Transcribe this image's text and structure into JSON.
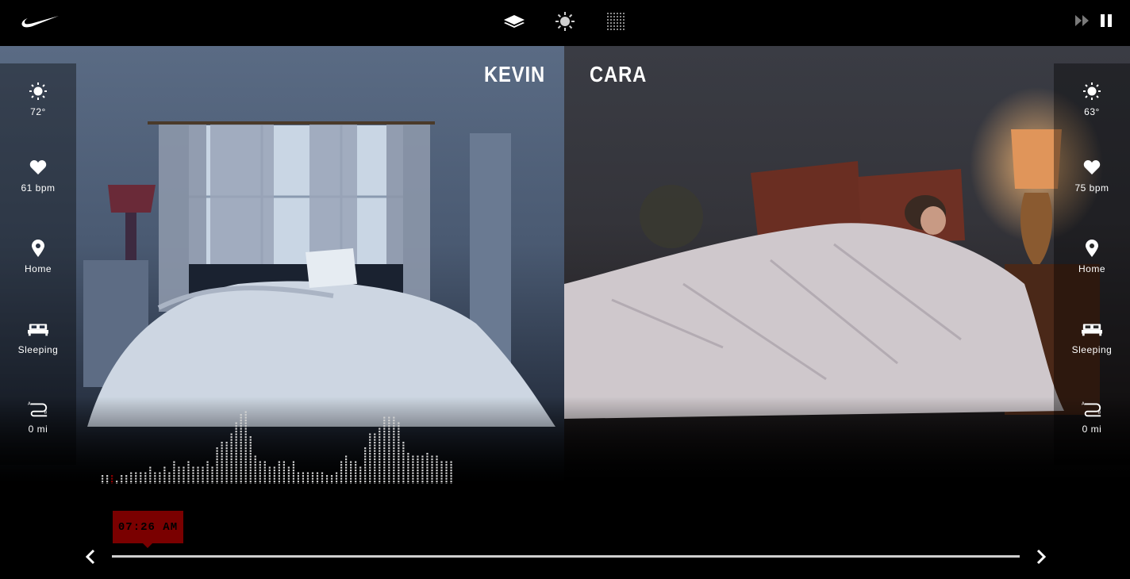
{
  "header": {
    "logo": "nike-swoosh-logo",
    "view_icons": [
      "layers-icon",
      "sun-icon",
      "grid-icon"
    ],
    "controls": [
      "fast-forward-icon",
      "pause-icon"
    ]
  },
  "people": [
    {
      "name": "KEVIN",
      "stats": [
        {
          "icon": "sun-icon",
          "label": "72°"
        },
        {
          "icon": "heart-icon",
          "label": "61 bpm"
        },
        {
          "icon": "location-pin-icon",
          "label": "Home"
        },
        {
          "icon": "bed-icon",
          "label": "Sleeping"
        },
        {
          "icon": "route-icon",
          "label": "0 mi"
        }
      ],
      "activity_levels": [
        2,
        2,
        2,
        1,
        2,
        2,
        3,
        3,
        3,
        3,
        4,
        3,
        3,
        4,
        3,
        5,
        4,
        4,
        5,
        4,
        4,
        4,
        5,
        4,
        8,
        9,
        9,
        11,
        13,
        15,
        18,
        10,
        6,
        5,
        5,
        4,
        4,
        5,
        5,
        4,
        5,
        3,
        3,
        3,
        3,
        3,
        3,
        2,
        2,
        3,
        5,
        6,
        5,
        5,
        4,
        8,
        11,
        11,
        12,
        14,
        14,
        14,
        13,
        9,
        7,
        6,
        6,
        6,
        7,
        6,
        6,
        5,
        5,
        5
      ]
    },
    {
      "name": "CARA",
      "stats": [
        {
          "icon": "sun-icon",
          "label": "63°"
        },
        {
          "icon": "heart-icon",
          "label": "75 bpm"
        },
        {
          "icon": "location-pin-icon",
          "label": "Home"
        },
        {
          "icon": "bed-icon",
          "label": "Sleeping"
        },
        {
          "icon": "route-icon",
          "label": "0 mi"
        }
      ],
      "activity_levels": [
        4,
        5,
        7,
        8,
        10,
        11,
        11,
        12,
        11,
        12,
        10,
        11,
        10,
        9,
        8,
        12,
        11,
        11,
        12,
        11,
        12,
        11,
        12,
        10,
        9,
        6,
        6,
        7,
        6,
        7,
        7,
        6,
        6,
        8,
        7,
        8,
        9,
        10,
        11,
        11,
        10,
        9,
        11,
        12,
        12,
        11,
        12,
        13,
        12,
        11,
        9,
        7,
        6,
        6,
        6,
        5,
        5,
        6,
        6,
        6,
        6,
        6,
        6,
        5,
        5,
        5,
        5,
        6,
        6,
        6,
        6,
        6,
        6,
        6,
        6
      ]
    }
  ],
  "timeline": {
    "current_time": "07:26 AM",
    "position": 0.02
  },
  "colors": {
    "accent": "#7a0000",
    "bar": "#d0d0d0",
    "marker": "#8b0000"
  }
}
